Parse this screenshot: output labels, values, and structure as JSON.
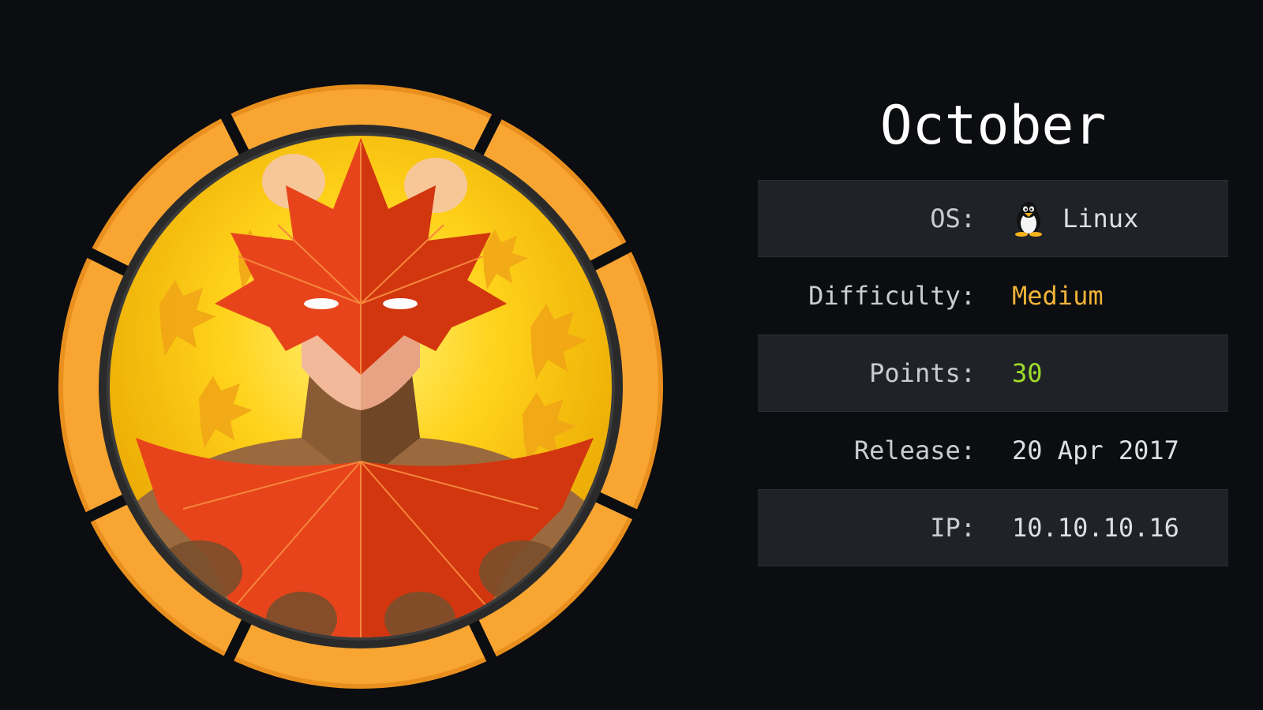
{
  "machine": {
    "name": "October",
    "avatar_icon": "maple-leaf-hero-badge",
    "ring_color": "#f8a532"
  },
  "info": {
    "os_label": "OS:",
    "os_value": "Linux",
    "os_icon": "tux-penguin-icon",
    "difficulty_label": "Difficulty:",
    "difficulty_value": "Medium",
    "difficulty_color": "#f2b338",
    "points_label": "Points:",
    "points_value": "30",
    "points_color": "#9fdc2a",
    "release_label": "Release:",
    "release_value": "20 Apr 2017",
    "ip_label": "IP:",
    "ip_value": "10.10.10.16"
  }
}
